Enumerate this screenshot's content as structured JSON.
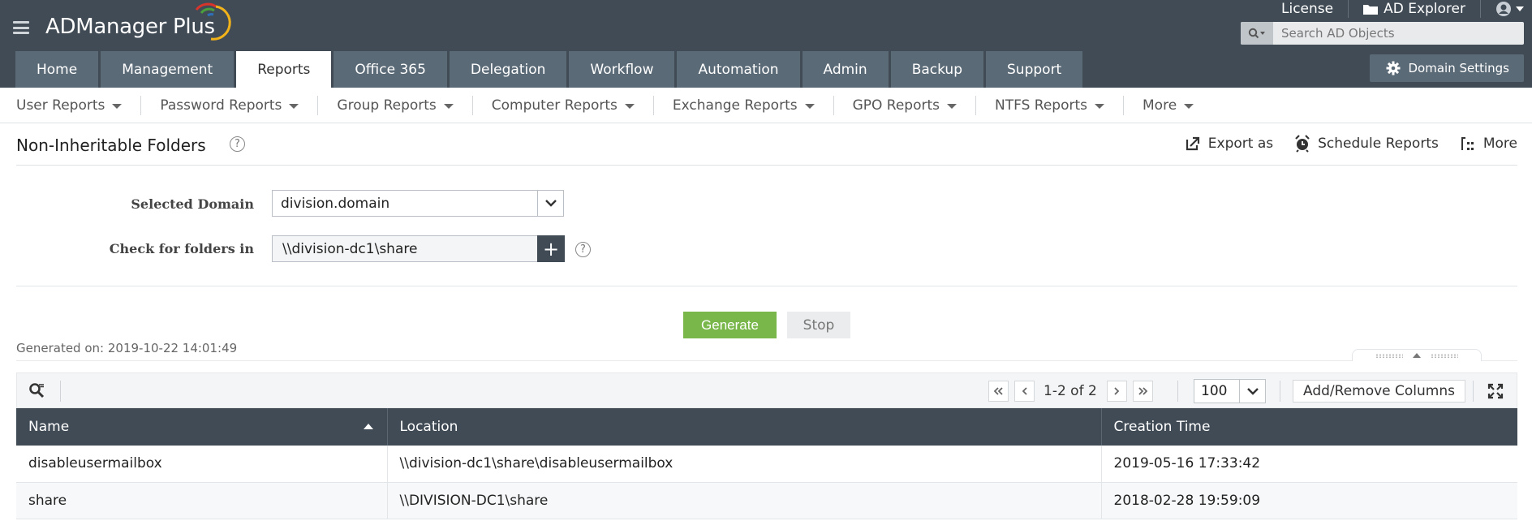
{
  "header": {
    "app_name": "ADManager Plus",
    "top_links": [
      {
        "label": "License",
        "icon": "none"
      },
      {
        "label": "AD Explorer",
        "icon": "folder-icon"
      },
      {
        "label": "",
        "icon": "user-icon"
      }
    ],
    "search": {
      "placeholder": "Search AD Objects",
      "value": ""
    },
    "tabs": [
      {
        "label": "Home",
        "active": false
      },
      {
        "label": "Management",
        "active": false
      },
      {
        "label": "Reports",
        "active": true
      },
      {
        "label": "Office 365",
        "active": false
      },
      {
        "label": "Delegation",
        "active": false
      },
      {
        "label": "Workflow",
        "active": false
      },
      {
        "label": "Automation",
        "active": false
      },
      {
        "label": "Admin",
        "active": false
      },
      {
        "label": "Backup",
        "active": false
      },
      {
        "label": "Support",
        "active": false
      }
    ],
    "domain_settings_label": "Domain Settings"
  },
  "subnav": {
    "items": [
      {
        "label": "User Reports"
      },
      {
        "label": "Password Reports"
      },
      {
        "label": "Group Reports"
      },
      {
        "label": "Computer Reports"
      },
      {
        "label": "Exchange Reports"
      },
      {
        "label": "GPO Reports"
      },
      {
        "label": "NTFS Reports"
      },
      {
        "label": "More"
      }
    ]
  },
  "page": {
    "title": "Non-Inheritable Folders",
    "help_glyph": "?",
    "actions": [
      {
        "label": "Export as",
        "icon": "export-icon"
      },
      {
        "label": "Schedule Reports",
        "icon": "alarm-clock-icon"
      },
      {
        "label": "More",
        "icon": "more-icon"
      }
    ]
  },
  "form": {
    "domain_label": "Selected Domain",
    "domain_value": "division.domain",
    "folders_label": "Check for folders in",
    "folders_value": "\\\\division-dc1\\share",
    "add_glyph": "+",
    "generate_label": "Generate",
    "stop_label": "Stop",
    "generated_on": "Generated on: 2019-10-22 14:01:49"
  },
  "toolbar": {
    "page_info": "1-2 of 2",
    "rows_per_page": "100",
    "add_remove_columns": "Add/Remove Columns"
  },
  "table": {
    "columns": [
      "Name",
      "Location",
      "Creation Time"
    ],
    "sorted_column": "Name",
    "sort_direction": "ascending",
    "rows": [
      {
        "name": "disableusermailbox",
        "location": "\\\\division-dc1\\share\\disableusermailbox",
        "created": "2019-05-16 17:33:42"
      },
      {
        "name": "share",
        "location": "\\\\DIVISION-DC1\\share",
        "created": "2018-02-28 19:59:09"
      }
    ]
  },
  "colors": {
    "header_bg": "#404b56",
    "tab_bg": "#5b6a77",
    "generate_green": "#79b74b",
    "logo_arc_red": "#d9342b",
    "logo_arc_green": "#4c9f3d",
    "logo_arc_blue": "#2f6fb7",
    "logo_arc_yellow": "#f2b31a"
  }
}
